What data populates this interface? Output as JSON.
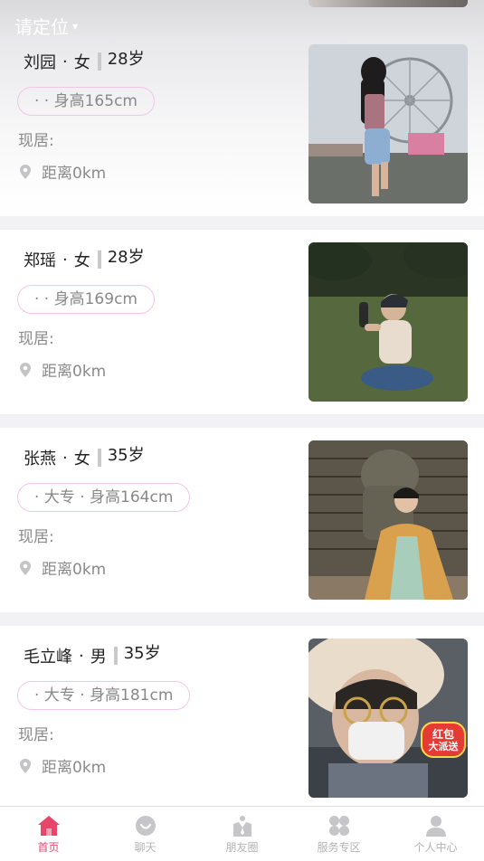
{
  "header": {
    "location_label": "请定位",
    "caret": "▾"
  },
  "profiles": [
    {
      "name": "刘园",
      "sep": "·",
      "gender": "女",
      "age": "28岁",
      "tags": "· · 身高165cm",
      "residence": "现居:",
      "distance": "距离0km",
      "photo_icon": "photo-ferris-wheel"
    },
    {
      "name": "郑瑶",
      "sep": "·",
      "gender": "女",
      "age": "28岁",
      "tags": "· · 身高169cm",
      "residence": "现居:",
      "distance": "距离0km",
      "photo_icon": "photo-park"
    },
    {
      "name": "张燕",
      "sep": "·",
      "gender": "女",
      "age": "35岁",
      "tags": "· 大专 · 身高164cm",
      "residence": "现居:",
      "distance": "距离0km",
      "photo_icon": "photo-stone-lion"
    },
    {
      "name": "毛立峰",
      "sep": "·",
      "gender": "男",
      "age": "35岁",
      "tags": "· 大专 · 身高181cm",
      "residence": "现居:",
      "distance": "距离0km",
      "photo_icon": "photo-selfie",
      "badge": [
        "红包",
        "大派送"
      ]
    }
  ],
  "tabs": [
    {
      "label": "首页",
      "icon": "home-icon",
      "active": true
    },
    {
      "label": "聊天",
      "icon": "chat-icon",
      "active": false
    },
    {
      "label": "朋友圈",
      "icon": "moments-icon",
      "active": false
    },
    {
      "label": "服务专区",
      "icon": "services-icon",
      "active": false
    },
    {
      "label": "个人中心",
      "icon": "profile-icon",
      "active": false
    }
  ],
  "colors": {
    "accent": "#e8456b",
    "tag_border": "#f3c6e9",
    "muted_text": "#8a8a8a",
    "inactive_icon": "#c6c6c8"
  }
}
